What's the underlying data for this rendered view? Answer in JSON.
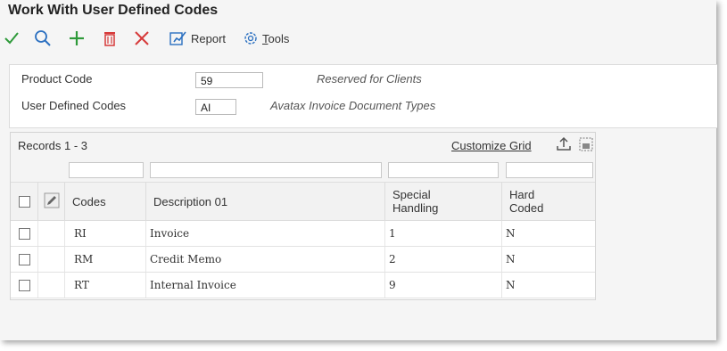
{
  "window": {
    "title": "Work With User Defined Codes"
  },
  "toolbar": {
    "select_icon": "checkmark-icon",
    "find_icon": "search-icon",
    "add_icon": "plus-icon",
    "delete_icon": "trash-icon",
    "close_icon": "close-icon",
    "report_label": "Report",
    "tools_label_rest": "ools",
    "tools_label_first": "T"
  },
  "header": {
    "product_code": {
      "label": "Product Code",
      "value": "59",
      "description": "Reserved for Clients"
    },
    "udc": {
      "label": "User Defined Codes",
      "value": "AI",
      "description": "Avatax Invoice Document Types"
    }
  },
  "grid": {
    "records_label": "Records 1 - 3",
    "customize_label": "Customize Grid",
    "columns": {
      "codes": "Codes",
      "description": "Description 01",
      "special_1": "Special",
      "special_2": "Handling",
      "hard_1": "Hard",
      "hard_2": "Coded"
    },
    "rows": [
      {
        "code": "RI",
        "description": "Invoice",
        "special": "1",
        "hard": "N"
      },
      {
        "code": "RM",
        "description": "Credit Memo",
        "special": "2",
        "hard": "N"
      },
      {
        "code": "RT",
        "description": "Internal Invoice",
        "special": "9",
        "hard": "N"
      }
    ]
  },
  "colors": {
    "accent_green": "#2e9a3a",
    "accent_blue": "#2a6fc0",
    "delete_red": "#d63a3a"
  }
}
